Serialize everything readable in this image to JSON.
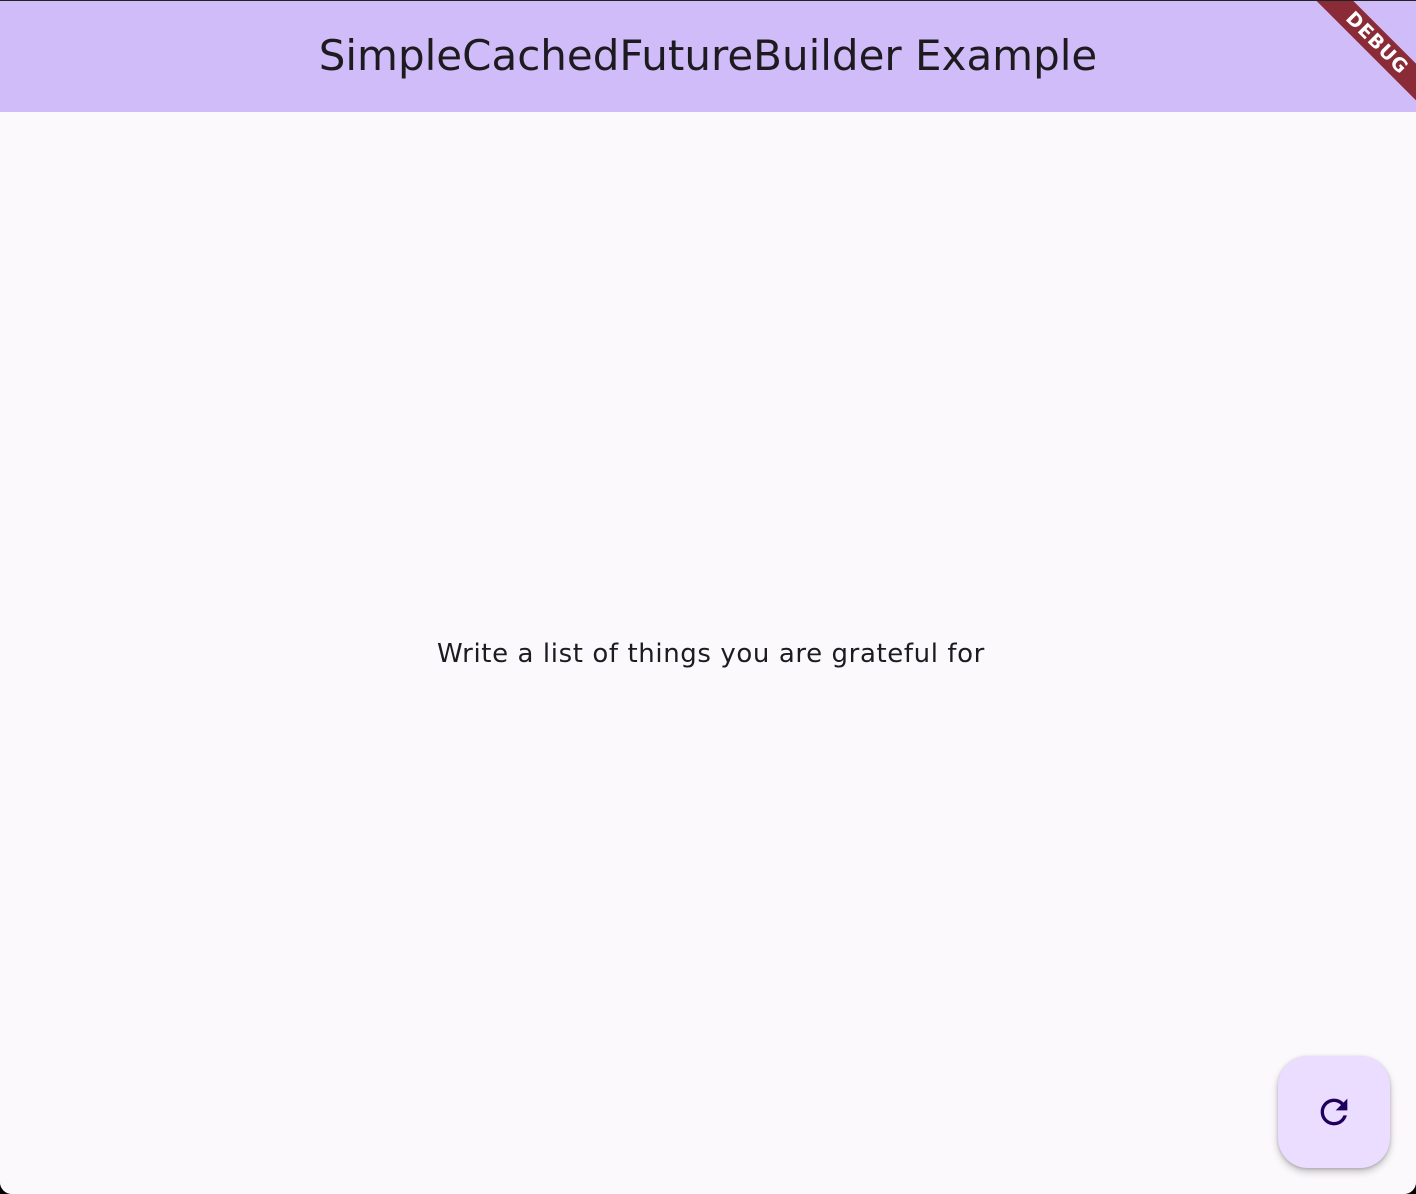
{
  "app_bar": {
    "title": "SimpleCachedFutureBuilder Example",
    "background_color": "#d0bcf8"
  },
  "debug_banner": {
    "label": "DEBUG",
    "color": "#8a2b37"
  },
  "main": {
    "prompt": "Write a list of things you are grateful for",
    "background_color": "#fcf9fd"
  },
  "fab": {
    "icon": "refresh-icon",
    "background_color": "#eaddff",
    "icon_color": "#21005d"
  }
}
